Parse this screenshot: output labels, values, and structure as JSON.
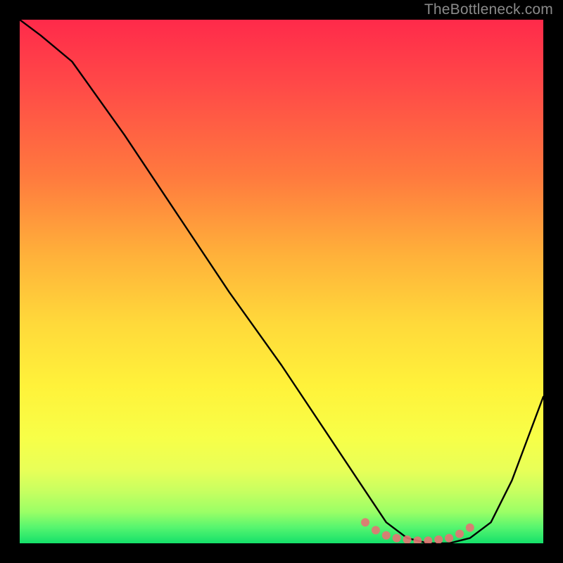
{
  "watermark": "TheBottleneck.com",
  "chart_data": {
    "type": "line",
    "title": "",
    "xlabel": "",
    "ylabel": "",
    "xlim": [
      0,
      100
    ],
    "ylim": [
      0,
      100
    ],
    "grid": false,
    "series": [
      {
        "name": "bottleneck-curve",
        "x": [
          0,
          4,
          10,
          20,
          30,
          40,
          50,
          60,
          66,
          70,
          74,
          78,
          82,
          86,
          90,
          94,
          97,
          100
        ],
        "values": [
          100,
          97,
          92,
          78,
          63,
          48,
          34,
          19,
          10,
          4,
          1,
          0,
          0,
          1,
          4,
          12,
          20,
          28
        ]
      },
      {
        "name": "optimal-band-markers",
        "x": [
          66,
          68,
          70,
          72,
          74,
          76,
          78,
          80,
          82,
          84,
          86
        ],
        "values": [
          4.0,
          2.5,
          1.5,
          1.0,
          0.7,
          0.5,
          0.5,
          0.7,
          1.0,
          1.8,
          3.0
        ]
      }
    ],
    "background_gradient": {
      "top": "#ff2a4a",
      "mid": "#ffe03a",
      "bottom": "#14e06a"
    },
    "annotations": []
  }
}
